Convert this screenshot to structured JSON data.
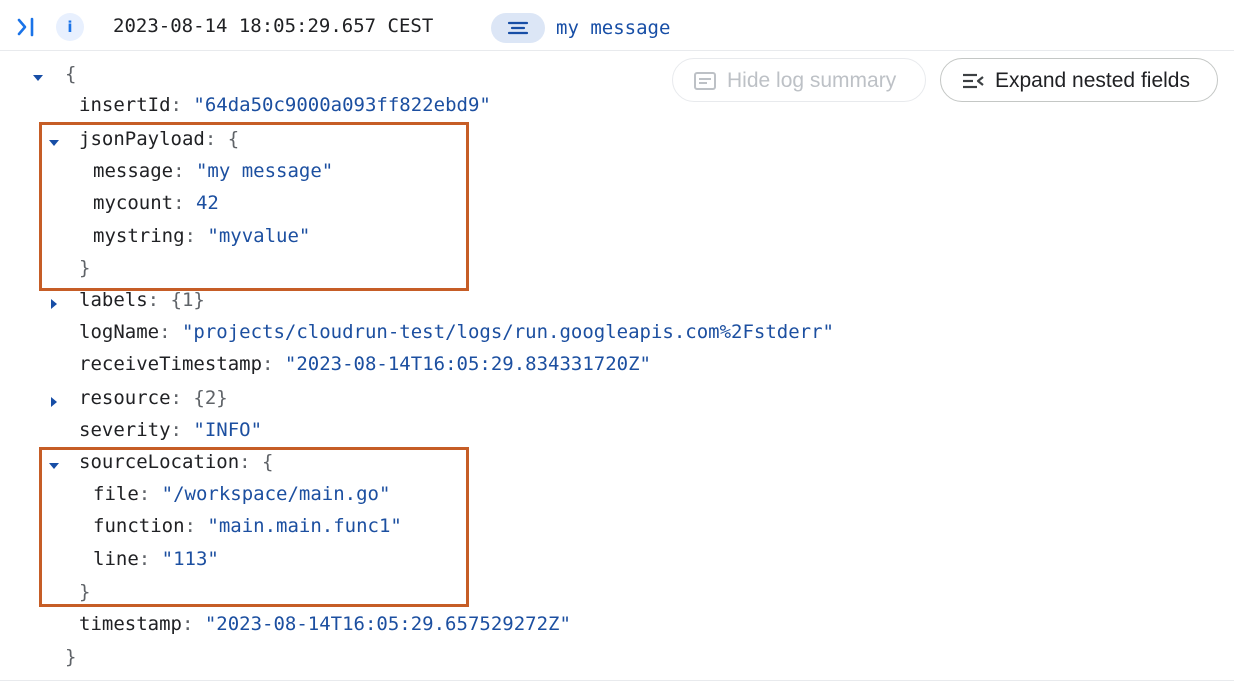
{
  "header": {
    "timestamp": "2023-08-14 18:05:29.657 CEST",
    "info_label": "i",
    "summary": "my message"
  },
  "actions": {
    "hide_summary": "Hide log summary",
    "expand_nested": "Expand nested fields"
  },
  "log": {
    "open_brace": "{",
    "close_brace": "}",
    "insertId": {
      "key": "insertId",
      "value": "\"64da50c9000a093ff822ebd9\""
    },
    "jsonPayload": {
      "key": "jsonPayload",
      "open": "{",
      "close": "}",
      "message": {
        "key": "message",
        "value": "\"my message\""
      },
      "mycount": {
        "key": "mycount",
        "value": "42"
      },
      "mystring": {
        "key": "mystring",
        "value": "\"myvalue\""
      }
    },
    "labels": {
      "key": "labels",
      "value": "{1}"
    },
    "logName": {
      "key": "logName",
      "value": "\"projects/cloudrun-test/logs/run.googleapis.com%2Fstderr\""
    },
    "receiveTimestamp": {
      "key": "receiveTimestamp",
      "value": "\"2023-08-14T16:05:29.834331720Z\""
    },
    "resource": {
      "key": "resource",
      "value": "{2}"
    },
    "severity": {
      "key": "severity",
      "value": "\"INFO\""
    },
    "sourceLocation": {
      "key": "sourceLocation",
      "open": "{",
      "close": "}",
      "file": {
        "key": "file",
        "value": "\"/workspace/main.go\""
      },
      "function": {
        "key": "function",
        "value": "\"main.main.func1\""
      },
      "line": {
        "key": "line",
        "value": "\"113\""
      }
    },
    "timestamp": {
      "key": "timestamp",
      "value": "\"2023-08-14T16:05:29.657529272Z\""
    }
  },
  "colors": {
    "accent": "#1a73e8",
    "value_text": "#1c4fa0",
    "highlight_border": "#c65d26"
  },
  "icons": {
    "expand_column": "expand-column-icon",
    "info": "info-icon",
    "summary": "summary-lines-icon",
    "hide_summary": "summary-card-icon",
    "expand_nested": "expand-nested-icon",
    "expanded": "caret-down-icon",
    "collapsed": "caret-right-icon"
  }
}
